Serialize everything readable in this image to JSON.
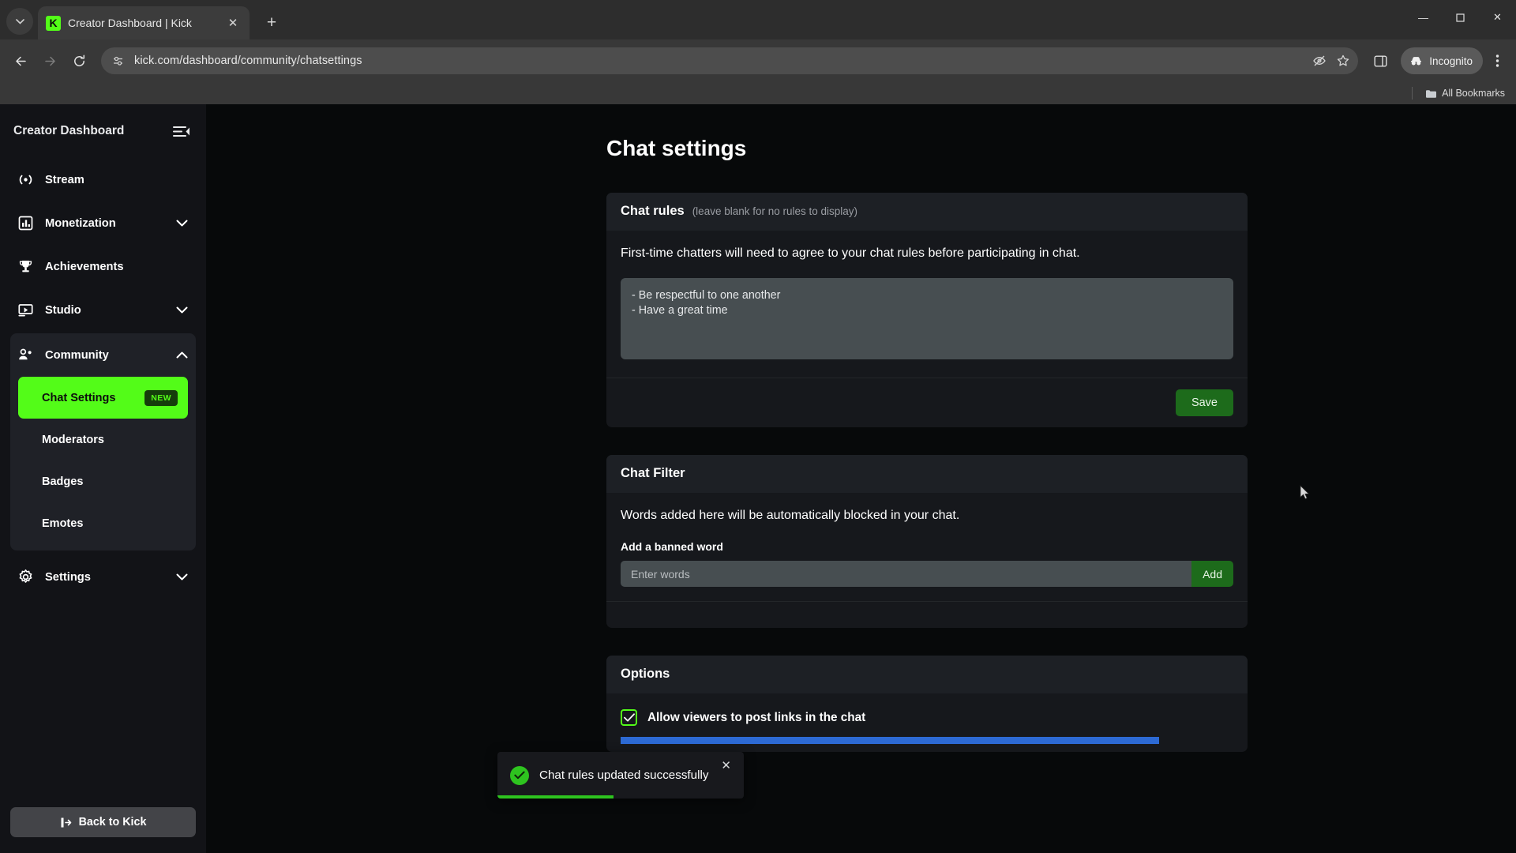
{
  "browser": {
    "tab": {
      "title": "Creator Dashboard | Kick",
      "favicon_letter": "K"
    },
    "tab_list_icon": "chevron-down-icon",
    "new_tab_label": "+",
    "close_tab_label": "✕",
    "window_controls": {
      "minimize": "—",
      "maximize": "❐",
      "close": "✕"
    },
    "nav": {
      "back": "←",
      "forward": "→",
      "reload": "↻"
    },
    "omnibox": {
      "url": "kick.com/dashboard/community/chatsettings",
      "site_settings_icon": "tune-icon",
      "third_party_cookie_icon": "eye-slash-icon",
      "bookmark_icon": "star-icon"
    },
    "side_panel_icon": "side-panel-icon",
    "incognito_label": "Incognito",
    "incognito_icon": "incognito-hat-icon",
    "menu_icon": "kebab-menu-icon",
    "bookmarks": {
      "folder_icon": "folder-icon",
      "all_bookmarks_label": "All Bookmarks"
    }
  },
  "sidebar": {
    "title": "Creator Dashboard",
    "collapse_icon": "collapse-sidebar-icon",
    "items": [
      {
        "label": "Stream",
        "icon": "broadcast-icon",
        "expandable": false
      },
      {
        "label": "Monetization",
        "icon": "bar-chart-icon",
        "expandable": true,
        "chevron": "chevron-down-icon"
      },
      {
        "label": "Achievements",
        "icon": "trophy-icon",
        "expandable": false
      },
      {
        "label": "Studio",
        "icon": "video-player-icon",
        "expandable": true,
        "chevron": "chevron-down-icon"
      }
    ],
    "community": {
      "label": "Community",
      "icon": "people-icon",
      "chevron": "chevron-up-icon",
      "expanded": true,
      "subitems": [
        {
          "label": "Chat Settings",
          "active": true,
          "badge": "NEW"
        },
        {
          "label": "Moderators",
          "active": false,
          "badge": ""
        },
        {
          "label": "Badges",
          "active": false,
          "badge": ""
        },
        {
          "label": "Emotes",
          "active": false,
          "badge": ""
        }
      ]
    },
    "settings": {
      "label": "Settings",
      "icon": "gear-icon",
      "chevron": "chevron-down-icon"
    },
    "back_to_kick": {
      "label": "Back to Kick",
      "icon": "exit-icon"
    }
  },
  "main": {
    "page_title": "Chat settings",
    "chat_rules": {
      "heading": "Chat rules",
      "subheading": "(leave blank for no rules to display)",
      "description": "First-time chatters will need to agree to your chat rules before participating in chat.",
      "textarea_value": "- Be respectful to one another\n- Have a great time",
      "save_label": "Save"
    },
    "chat_filter": {
      "heading": "Chat Filter",
      "description": "Words added here will be automatically blocked in your chat.",
      "field_label": "Add a banned word",
      "input_placeholder": "Enter words",
      "input_value": "",
      "add_label": "Add"
    },
    "options": {
      "heading": "Options",
      "checkbox_label": "Allow viewers to post links in the chat",
      "checkbox_checked": true,
      "check_glyph": "✓"
    }
  },
  "toast": {
    "message": "Chat rules updated successfully",
    "icon": "success-check-icon",
    "check_glyph": "✓",
    "close_glyph": "✕",
    "progress_percent": 47
  },
  "colors": {
    "kick_green": "#53fc18",
    "badge_bg": "#153d0b",
    "save_green": "#1d6b1b",
    "toast_green": "#2ec41f",
    "card_bg": "#16181c",
    "sidebar_bg": "#121317"
  }
}
